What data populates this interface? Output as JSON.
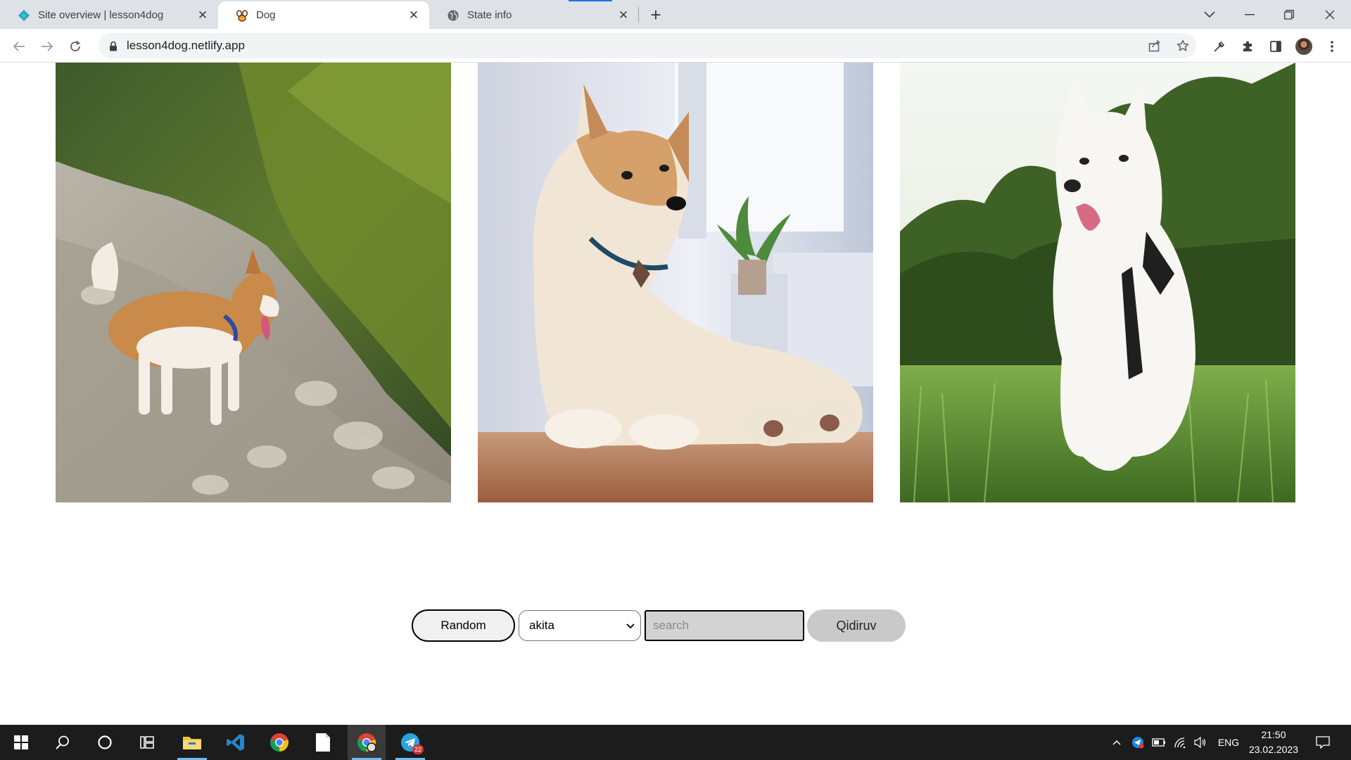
{
  "browser": {
    "tabs": [
      {
        "title": "Site overview | lesson4dog",
        "favicon": "netlify-diamond-icon",
        "active": false
      },
      {
        "title": "Dog",
        "favicon": "paw-icon",
        "active": true
      },
      {
        "title": "State info",
        "favicon": "globe-icon",
        "active": false
      }
    ],
    "new_tab_label": "+",
    "url": "lesson4dog.netlify.app"
  },
  "gallery": {
    "images": [
      {
        "alt": "akita on rocky hillside"
      },
      {
        "alt": "akita lying on floor"
      },
      {
        "alt": "white akita in grass"
      }
    ]
  },
  "controls": {
    "random_label": "Random",
    "breed_selected": "akita",
    "search_placeholder": "search",
    "search_value": "",
    "search_button_label": "Qidiruv"
  },
  "taskbar": {
    "apps": [
      "windows-start-icon",
      "search-icon",
      "cortana-icon",
      "task-view-icon",
      "file-explorer-icon",
      "vscode-icon",
      "chrome-icon",
      "notepad-icon",
      "chrome-profile-icon",
      "telegram-icon"
    ],
    "telegram_badge": "22",
    "language": "ENG",
    "time": "21:50",
    "date": "23.02.2023"
  }
}
